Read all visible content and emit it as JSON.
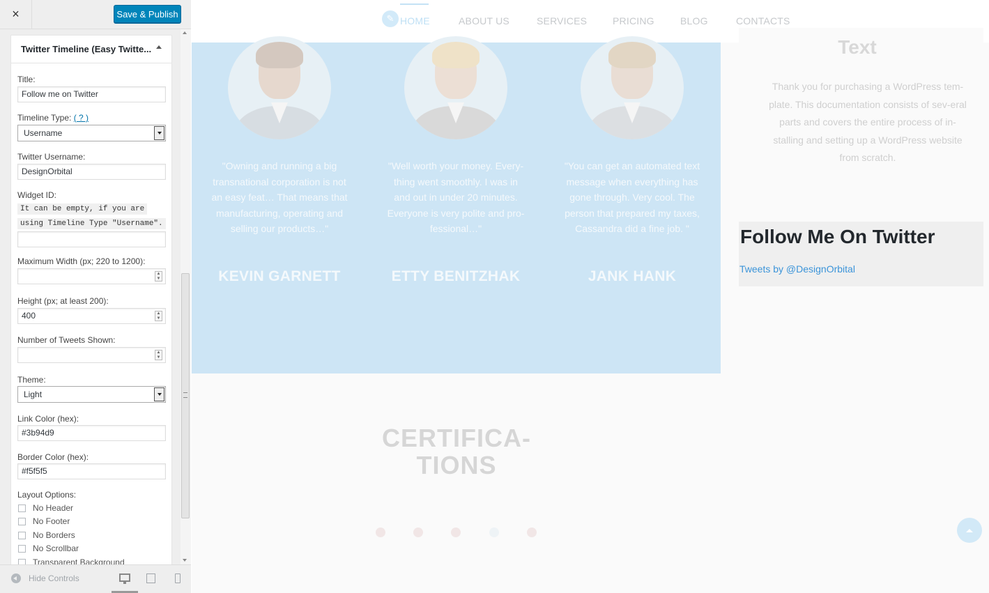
{
  "sidebar": {
    "close_glyph": "×",
    "save_label": "Save & Publish",
    "widget_title": "Twitter Timeline (Easy Twitte...",
    "fields": {
      "title_label": "Title:",
      "title_value": "Follow me on Twitter",
      "timeline_type_label": "Timeline Type:",
      "timeline_type_help": "( ? )",
      "timeline_type_value": "Username",
      "username_label": "Twitter Username:",
      "username_value": "DesignOrbital",
      "widget_id_label": "Widget ID:",
      "widget_id_note_1": "It can be empty, if you are",
      "widget_id_note_2": "using Timeline Type \"Username\".",
      "widget_id_value": "",
      "max_width_label": "Maximum Width (px; 220 to 1200):",
      "max_width_value": "",
      "height_label": "Height (px; at least 200):",
      "height_value": "400",
      "tweets_label": "Number of Tweets Shown:",
      "tweets_value": "",
      "theme_label": "Theme:",
      "theme_value": "Light",
      "link_color_label": "Link Color (hex):",
      "link_color_value": "#3b94d9",
      "border_color_label": "Border Color (hex):",
      "border_color_value": "#f5f5f5",
      "layout_label": "Layout Options:",
      "layout_options": [
        "No Header",
        "No Footer",
        "No Borders",
        "No Scrollbar",
        "Transparent Background"
      ]
    },
    "footer": {
      "hide_controls": "Hide Controls",
      "devices": [
        "desktop-icon",
        "tablet-icon",
        "mobile-icon"
      ]
    }
  },
  "preview": {
    "nav": [
      "HOME",
      "ABOUT US",
      "SERVICES",
      "PRICING",
      "BLOG",
      "CONTACTS"
    ],
    "testimonials": [
      {
        "quote": "\"Owning and running a big transnational corporation is not an easy feat… That means that manufacturing, operating and selling our products…\"",
        "name": "KEVIN GARNETT"
      },
      {
        "quote": "\"Well worth your money. Every-thing went smoothly. I was in and out in under 20 minutes. Everyone is very polite and pro-fessional…\"",
        "name": "ETTY BENITZHAK"
      },
      {
        "quote": "\"You can get an automated text message when everything has gone through. Very cool. The person that prepared my taxes, Cassandra did a fine job. \"",
        "name": "JANK HANK"
      }
    ],
    "text_widget": {
      "title": "Text",
      "body": "Thank you for purchasing a WordPress tem-plate. This documentation consists of sev-eral parts and covers the entire process of in-stalling and setting up a WordPress website from scratch."
    },
    "twitter_widget": {
      "title": "Follow Me On Twitter",
      "link": "Tweets by @DesignOrbital"
    },
    "certifications_title_1": "CERTIFICA-",
    "certifications_title_2": "TIONS"
  },
  "colors": {
    "accent": "#0085ba",
    "link": "#3b94d9",
    "testimonial_bg": "#cde5f5"
  }
}
